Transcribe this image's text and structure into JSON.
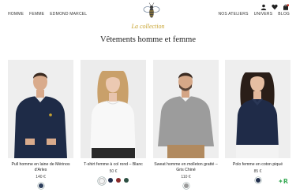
{
  "nav": {
    "left": [
      "HOMME",
      "FEMME",
      "EDMOND MARCEL"
    ],
    "right": [
      "NOS ATELIERS",
      "UNIVERS",
      "BLOG"
    ]
  },
  "header": {
    "icons": [
      "user-icon",
      "heart-icon",
      "bag-icon"
    ]
  },
  "hero": {
    "subtitle": "La collection",
    "title": "Vêtements homme et femme"
  },
  "products": [
    {
      "name": "Pull homme en laine de Mérinos d'Arles",
      "price": "140 €",
      "swatches": [
        "#2c3e5c"
      ],
      "selected": 0
    },
    {
      "name": "T-shirt femme à col rond – Blanc",
      "price": "50 €",
      "swatches": [
        "#f4f4f4",
        "#1f2d4a",
        "#8a2a2a",
        "#2c4f42"
      ],
      "selected": 0
    },
    {
      "name": "Sweat homme en molleton gratté – Gris Chiné",
      "price": "110 €",
      "swatches": [
        "#9a9a9a"
      ],
      "selected": 0
    },
    {
      "name": "Polo femme en coton piqué",
      "price": "85 €",
      "swatches": [
        "#22304d"
      ],
      "selected": 0
    }
  ],
  "colors": {
    "accent": "#c8a431",
    "widget": "#3fae5b"
  }
}
